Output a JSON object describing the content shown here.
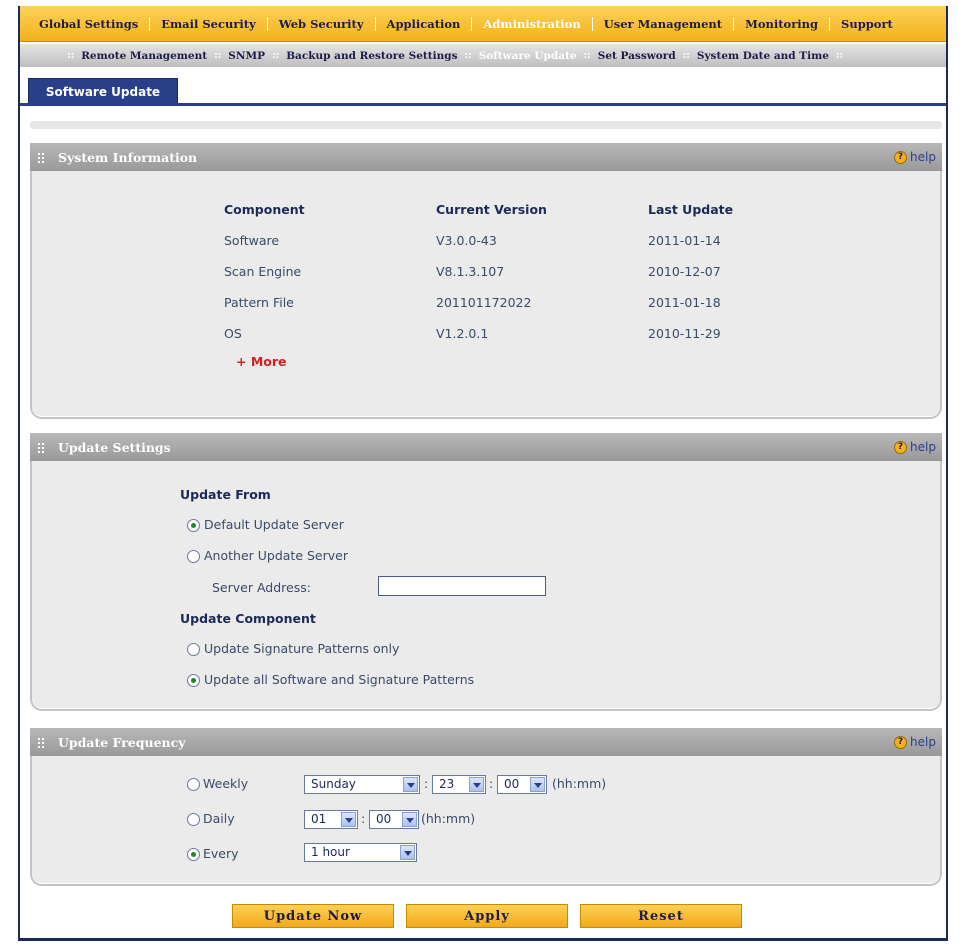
{
  "nav": {
    "items": [
      "Global Settings",
      "Email Security",
      "Web Security",
      "Application",
      "Administration",
      "User Management",
      "Monitoring",
      "Support"
    ],
    "active": "Administration"
  },
  "subnav": {
    "items": [
      "Remote Management",
      "SNMP",
      "Backup and Restore Settings",
      "Software Update",
      "Set Password",
      "System Date and Time"
    ],
    "active": "Software Update"
  },
  "tab": {
    "label": "Software Update"
  },
  "help_label": "help",
  "system_info": {
    "title": "System Information",
    "headers": {
      "component": "Component",
      "version": "Current Version",
      "last_update": "Last Update"
    },
    "rows": [
      {
        "component": "Software",
        "version": "V3.0.0-43",
        "last_update": "2011-01-14"
      },
      {
        "component": "Scan Engine",
        "version": "V8.1.3.107",
        "last_update": "2010-12-07"
      },
      {
        "component": "Pattern File",
        "version": "201101172022",
        "last_update": "2011-01-18"
      },
      {
        "component": "OS",
        "version": "V1.2.0.1",
        "last_update": "2010-11-29"
      }
    ],
    "more_label": "+ More"
  },
  "update_settings": {
    "title": "Update Settings",
    "from_label": "Update From",
    "default_server": "Default Update Server",
    "another_server": "Another Update Server",
    "server_address_label": "Server Address:",
    "server_address_value": "",
    "component_label": "Update Component",
    "signature_only": "Update Signature Patterns only",
    "all_software": "Update all Software and Signature Patterns"
  },
  "update_frequency": {
    "title": "Update Frequency",
    "weekly_label": "Weekly",
    "weekly_day": "Sunday",
    "weekly_hour": "23",
    "weekly_minute": "00",
    "weekly_hint": "(hh:mm)",
    "daily_label": "Daily",
    "daily_hour": "01",
    "daily_minute": "00",
    "daily_hint": "(hh:mm)",
    "every_label": "Every",
    "every_value": "1 hour",
    "colon": ":"
  },
  "buttons": {
    "update_now": "Update Now",
    "apply": "Apply",
    "reset": "Reset"
  }
}
